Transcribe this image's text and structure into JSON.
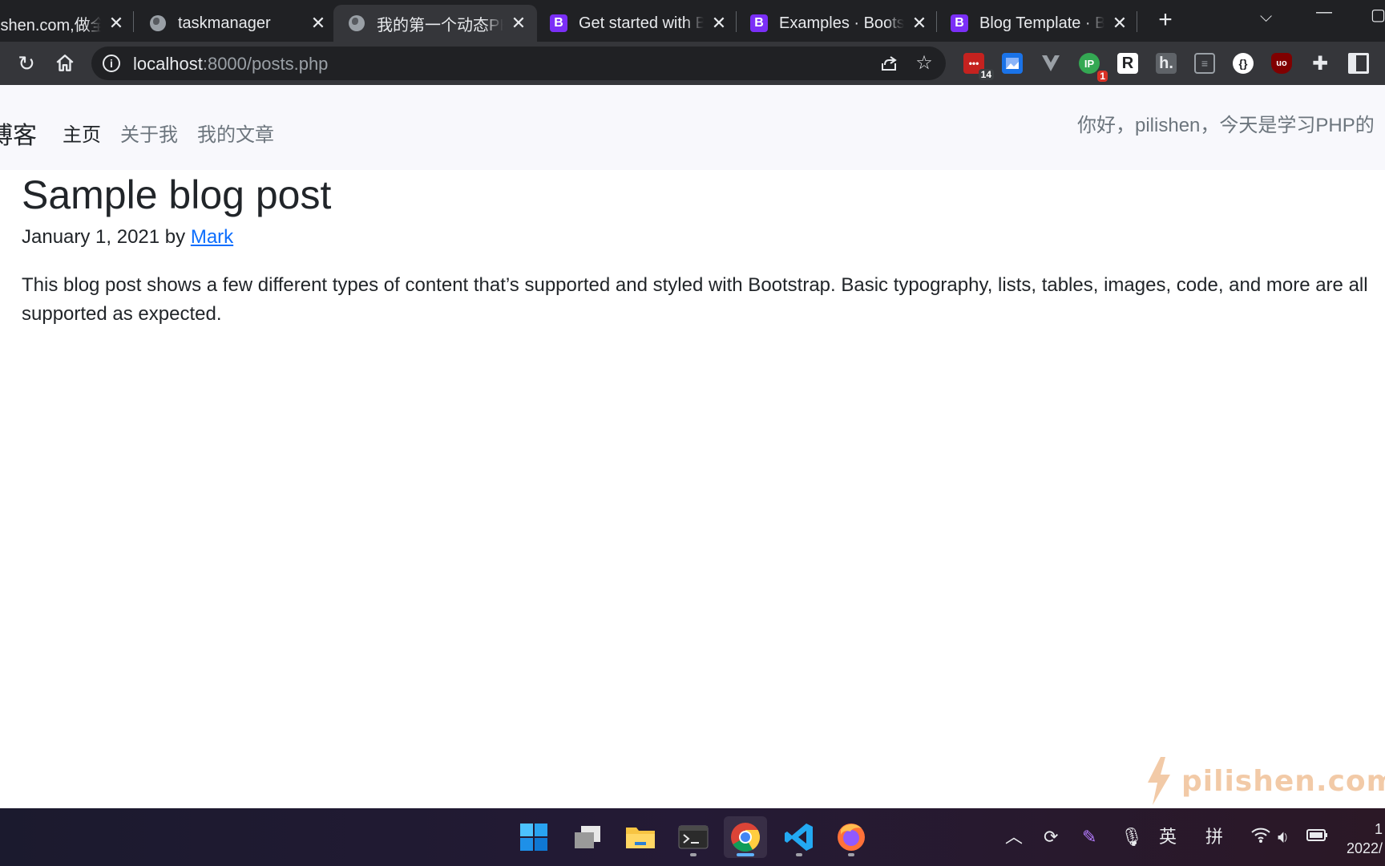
{
  "browser": {
    "tabs": [
      {
        "title": "ishen.com,做全",
        "favicon": "none",
        "active": false
      },
      {
        "title": "taskmanager",
        "favicon": "globe-icon",
        "active": false
      },
      {
        "title": "我的第一个动态PHP",
        "favicon": "globe-icon",
        "active": true
      },
      {
        "title": "Get started with Bootstrap",
        "favicon": "bootstrap-icon",
        "active": false
      },
      {
        "title": "Examples · Bootstrap",
        "favicon": "bootstrap-icon",
        "active": false
      },
      {
        "title": "Blog Template · Bootstrap",
        "favicon": "bootstrap-icon",
        "active": false
      }
    ],
    "address_bar": {
      "host": "localhost",
      "rest": ":8000/posts.php"
    },
    "extensions": [
      {
        "name": "todo-extension-icon",
        "badge": "14"
      },
      {
        "name": "photo-extension-icon",
        "badge": ""
      },
      {
        "name": "vue-devtools-icon",
        "badge": ""
      },
      {
        "name": "green-extension-icon",
        "badge": "1"
      },
      {
        "name": "r-extension-icon",
        "badge": ""
      },
      {
        "name": "h-extension-icon",
        "badge": ""
      },
      {
        "name": "reader-extension-icon",
        "badge": ""
      },
      {
        "name": "json-extension-icon",
        "badge": ""
      },
      {
        "name": "ublock-icon",
        "badge": ""
      },
      {
        "name": "puzzle-icon",
        "badge": ""
      },
      {
        "name": "sidepanel-icon",
        "badge": ""
      }
    ]
  },
  "site": {
    "brand": "博客",
    "nav": [
      {
        "label": "主页",
        "active": true
      },
      {
        "label": "关于我",
        "active": false
      },
      {
        "label": "我的文章",
        "active": false
      }
    ],
    "greeting": "你好，pilishen，今天是学习PHP的"
  },
  "post": {
    "title": "Sample blog post",
    "date": "January 1, 2021",
    "by": "by",
    "author": "Mark",
    "body": "This blog post shows a few different types of content that’s supported and styled with Bootstrap. Basic typography, lists, tables, images, code, and more are all supported as expected."
  },
  "watermark": {
    "text": "pilishen.com"
  },
  "taskbar": {
    "apps": [
      "start-icon",
      "task-view-icon",
      "file-explorer-icon",
      "terminal-icon",
      "chrome-icon",
      "vscode-icon",
      "firefox-icon"
    ],
    "tray": {
      "ime_lang": "英",
      "ime_mode": "拼"
    },
    "clock": {
      "time": "1",
      "date": "2022/"
    }
  },
  "colors": {
    "accent_link": "#0d6efd",
    "bootstrap_purple": "#7b2ff7",
    "navbar_bg": "#f8f8fc"
  }
}
